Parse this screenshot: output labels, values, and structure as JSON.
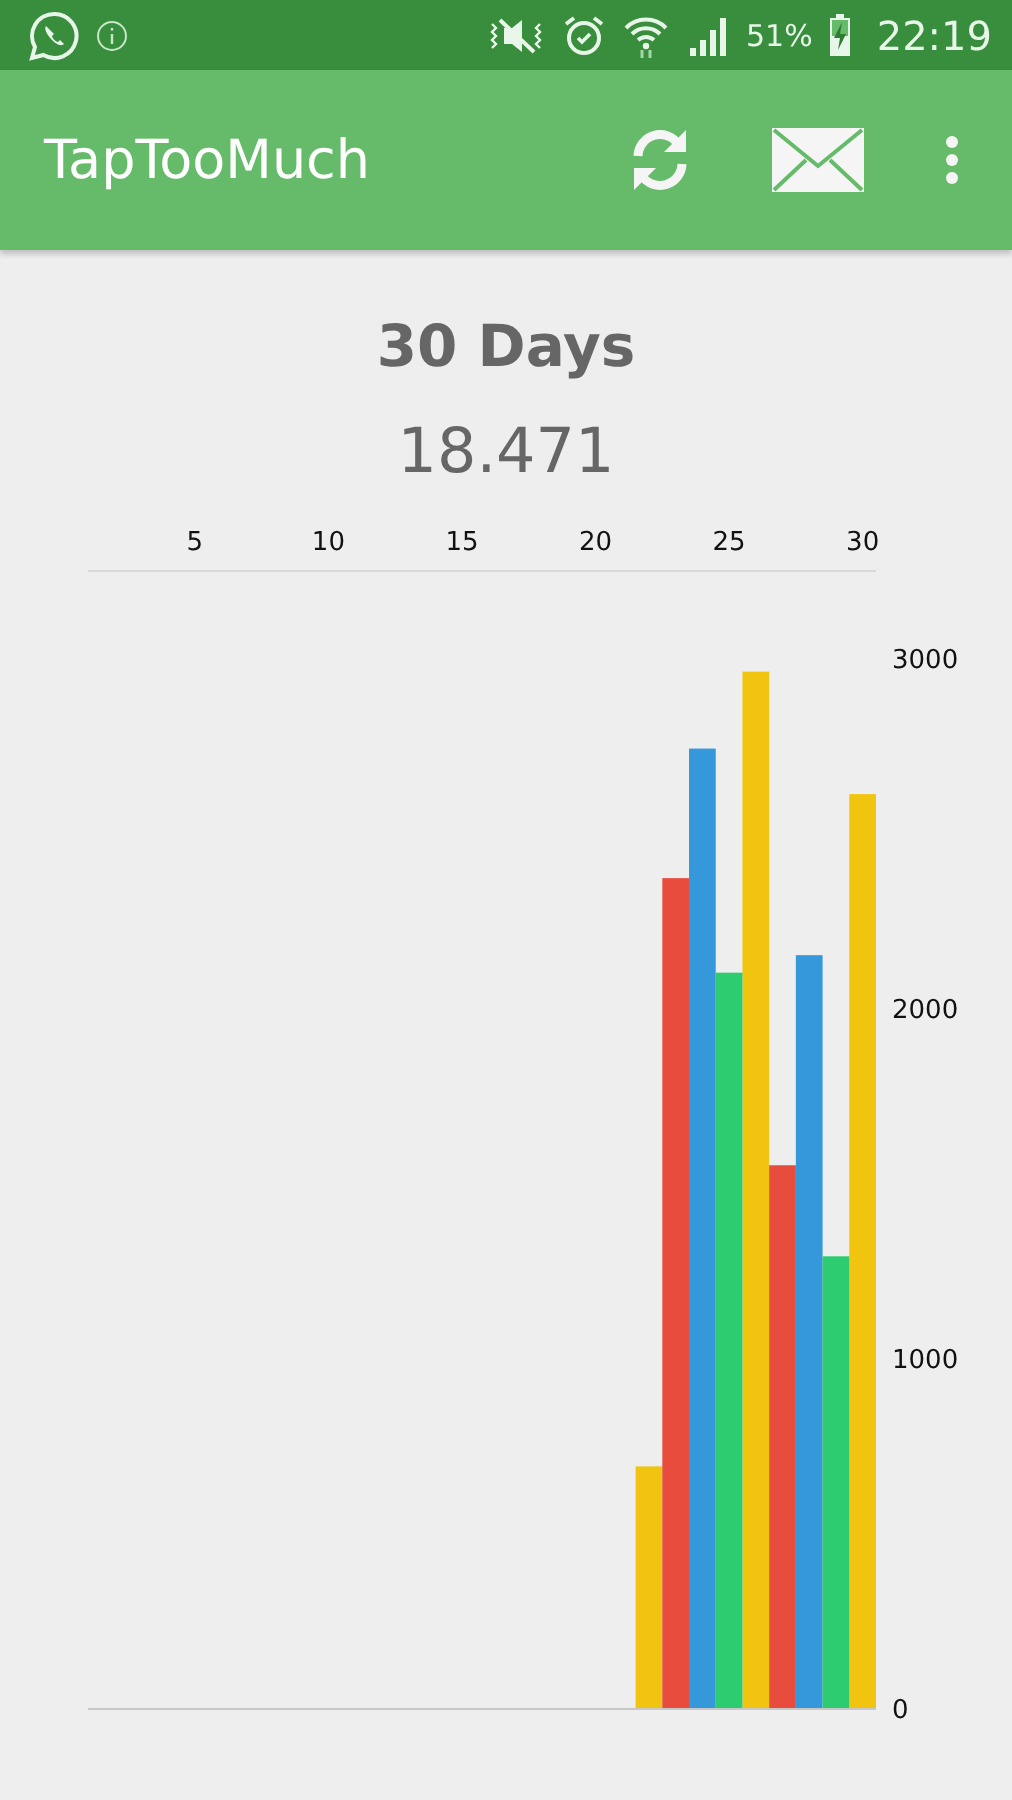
{
  "status_bar": {
    "battery": "51%",
    "time": "22:19"
  },
  "app_bar": {
    "title": "TapTooMuch"
  },
  "summary": {
    "period": "30 Days",
    "total": "18.471"
  },
  "chart_data": {
    "type": "bar",
    "x": [
      22,
      23,
      24,
      25,
      26,
      27,
      28,
      29,
      30
    ],
    "xlim": [
      1,
      30.5
    ],
    "ylim": [
      0,
      3250
    ],
    "xticks": [
      5,
      10,
      15,
      20,
      25,
      30
    ],
    "yticks": [
      0,
      1000,
      2000,
      3000
    ],
    "series": [
      {
        "color": "#f1c40f",
        "values": [
          690,
          null,
          null,
          null,
          2960,
          null,
          null,
          null,
          2610
        ]
      },
      {
        "color": "#e74c3c",
        "values": [
          null,
          2370,
          null,
          null,
          null,
          1550,
          null,
          null,
          null
        ]
      },
      {
        "color": "#3498db",
        "values": [
          null,
          null,
          2740,
          null,
          null,
          null,
          2150,
          null,
          null
        ]
      },
      {
        "color": "#2ecc71",
        "values": [
          null,
          null,
          null,
          2100,
          null,
          null,
          null,
          1290,
          null
        ]
      }
    ]
  }
}
